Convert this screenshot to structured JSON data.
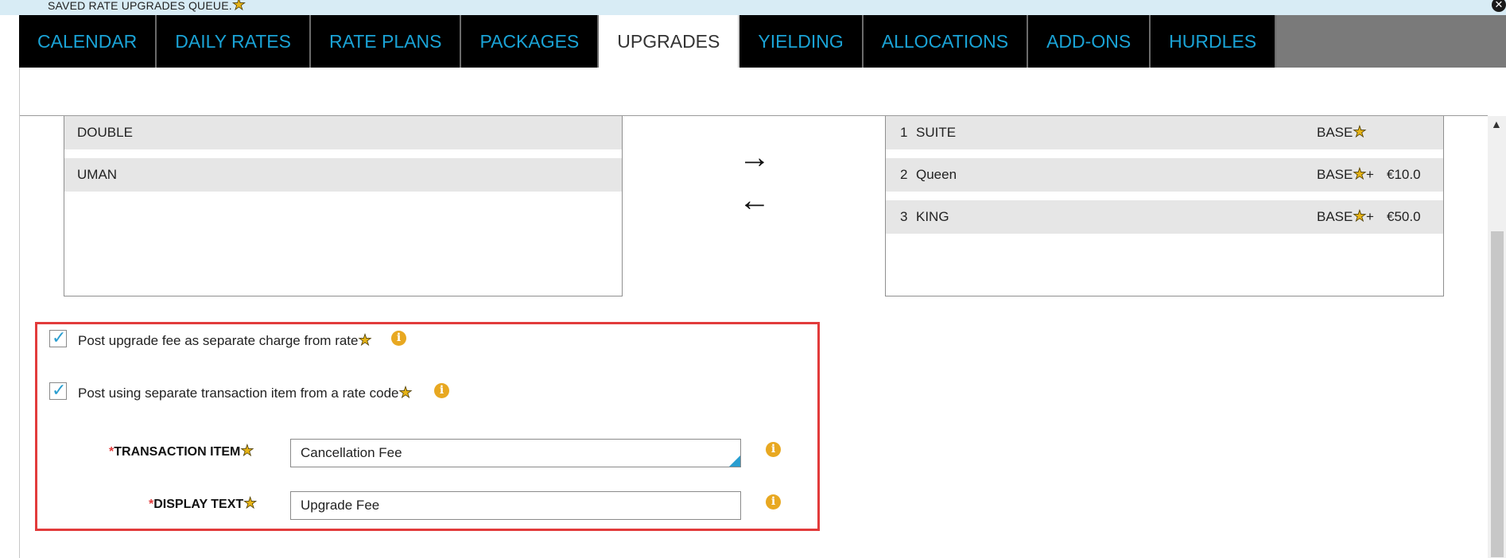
{
  "notification": {
    "text": "SAVED RATE UPGRADES QUEUE.",
    "close_icon": "close-icon"
  },
  "tabs": [
    {
      "label": "CALENDAR"
    },
    {
      "label": "DAILY RATES"
    },
    {
      "label": "RATE PLANS"
    },
    {
      "label": "PACKAGES"
    },
    {
      "label": "UPGRADES",
      "active": true
    },
    {
      "label": "YIELDING"
    },
    {
      "label": "ALLOCATIONS"
    },
    {
      "label": "ADD-ONS"
    },
    {
      "label": "HURDLES"
    }
  ],
  "available_list": [
    {
      "name": "DOUBLE"
    },
    {
      "name": "UMAN"
    }
  ],
  "upgrade_queue": [
    {
      "rank": "1",
      "name": "SUITE",
      "base": "BASE",
      "plus": "",
      "amount": ""
    },
    {
      "rank": "2",
      "name": "Queen",
      "base": "BASE",
      "plus": "+",
      "amount": "€10.0"
    },
    {
      "rank": "3",
      "name": "KING",
      "base": "BASE",
      "plus": "+",
      "amount": "€50.0"
    }
  ],
  "options": {
    "post_separate_charge": {
      "label": "Post upgrade fee as separate charge from rate",
      "checked": true
    },
    "post_separate_item": {
      "label": "Post using separate transaction item from a rate code",
      "checked": true
    },
    "transaction_item": {
      "label": "TRANSACTION ITEM",
      "required_mark": "*",
      "value": "Cancellation Fee"
    },
    "display_text": {
      "label": "DISPLAY TEXT",
      "required_mark": "*",
      "value": "Upgrade Fee"
    }
  },
  "colors": {
    "tab_text": "#1aa3d6",
    "tab_bg": "#000000",
    "highlight_border": "#e23b3b",
    "info_icon": "#e8a821",
    "checkbox_check": "#2a9ed0",
    "notification_bg": "#d8ecf5"
  }
}
